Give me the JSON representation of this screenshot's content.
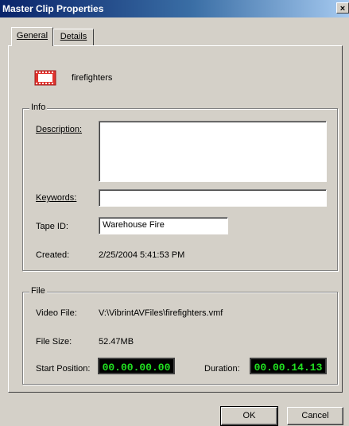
{
  "window": {
    "title": "Master Clip Properties",
    "close_glyph": "×"
  },
  "tabs": [
    {
      "label": "General",
      "active": true
    },
    {
      "label": "Details",
      "active": false
    }
  ],
  "clip": {
    "name": "firefighters",
    "icon": "film-clip-icon",
    "icon_color": "#e0342e"
  },
  "info": {
    "group_title": "Info",
    "description_label": "Description:",
    "description_value": "",
    "keywords_label": "Keywords:",
    "keywords_value": "",
    "tape_id_label": "Tape ID:",
    "tape_id_value": "Warehouse Fire",
    "created_label": "Created:",
    "created_value": "2/25/2004 5:41:53 PM"
  },
  "file": {
    "group_title": "File",
    "video_file_label": "Video File:",
    "video_file_value": "V:\\VibrintAVFiles\\firefighters.vmf",
    "file_size_label": "File Size:",
    "file_size_value": "52.47MB",
    "start_position_label": "Start Position:",
    "start_position_value": "00.00.00.00",
    "duration_label": "Duration:",
    "duration_value": "00.00.14.13",
    "timecode_color": "#21e021"
  },
  "buttons": {
    "ok_label": "OK",
    "cancel_label": "Cancel"
  }
}
